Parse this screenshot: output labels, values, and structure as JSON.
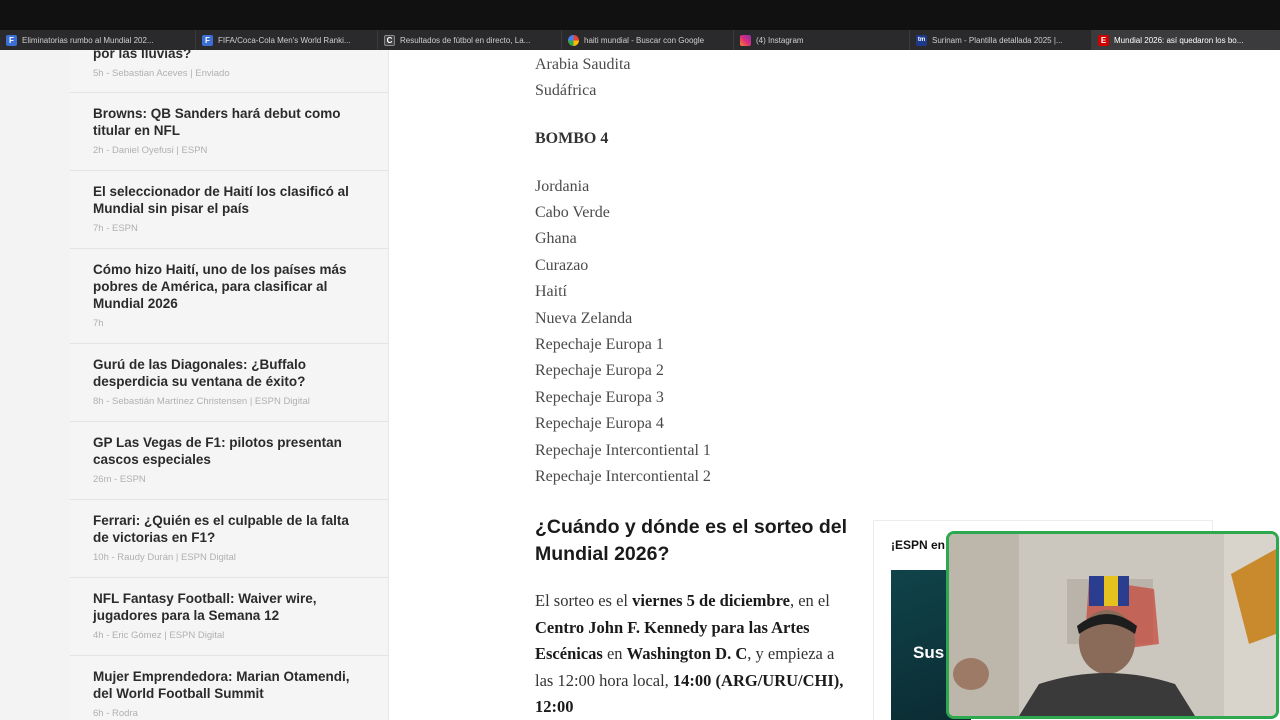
{
  "tabs": [
    {
      "label": "Eliminatorias rumbo al Mundial 202...",
      "icon": "f-icon",
      "color": "#3b6fd6"
    },
    {
      "label": "FIFA/Coca-Cola Men's World Ranki...",
      "icon": "f-icon",
      "color": "#3b6fd6"
    },
    {
      "label": "Resultados de fútbol en directo, La...",
      "icon": "c-icon",
      "color": "#444444"
    },
    {
      "label": "haiti mundial - Buscar con Google",
      "icon": "google-icon",
      "color": "#ea4335"
    },
    {
      "label": "(4) Instagram",
      "icon": "instagram-icon",
      "color": "#d6249f"
    },
    {
      "label": "Surinam - Plantilla detallada 2025 |...",
      "icon": "tm-icon",
      "color": "#1d3a8a"
    },
    {
      "label": "Mundial 2026: así quedaron los bo...",
      "icon": "espn-icon",
      "color": "#d00000"
    }
  ],
  "news": [
    {
      "title": "por las lluvias?",
      "meta": "5h  -  Sebastian Aceves | Enviado"
    },
    {
      "title": "Browns: QB Sanders hará debut como titular en NFL",
      "meta": "2h  -  Daniel Oyefusi | ESPN"
    },
    {
      "title": "El seleccionador de Haití los clasificó al Mundial sin pisar el país",
      "meta": "7h  -  ESPN"
    },
    {
      "title": "Cómo hizo Haití, uno de los países más pobres de América, para clasificar al Mundial 2026",
      "meta": "7h"
    },
    {
      "title": "Gurú de las Diagonales: ¿Buffalo desperdicia su ventana de éxito?",
      "meta": "8h  -  Sebastián Martínez Christensen | ESPN Digital"
    },
    {
      "title": "GP Las Vegas de F1: pilotos presentan cascos especiales",
      "meta": "26m  -  ESPN"
    },
    {
      "title": "Ferrari: ¿Quién es el culpable de la falta de victorias en F1?",
      "meta": "10h  -  Raudy Durán | ESPN Digital"
    },
    {
      "title": "NFL Fantasy Football: Waiver wire, jugadores para la Semana 12",
      "meta": "4h  -  Eric Gómez | ESPN Digital"
    },
    {
      "title": "Mujer Emprendedora: Marian Otamendi, del World Football Summit",
      "meta": "6h  -  Rodra"
    }
  ],
  "article": {
    "pot3_tail": [
      "Arabia Saudita",
      "Sudáfrica"
    ],
    "pot4_heading": "BOMBO 4",
    "pot4": [
      "Jordania",
      "Cabo Verde",
      "Ghana",
      "Curazao",
      "Haití",
      "Nueva Zelanda",
      "Repechaje Europa 1",
      "Repechaje Europa 2",
      "Repechaje Europa 3",
      "Repechaje Europa 4",
      "Repechaje Intercontiental 1",
      "Repechaje Intercontiental 2"
    ],
    "subheading": "¿Cuándo y dónde es el sorteo del Mundial 2026?",
    "para": {
      "t1": "El sorteo es el ",
      "b1": "viernes 5 de diciembre",
      "t2": ", en el ",
      "b2": "Centro John F. Kennedy para las Artes Escénicas",
      "t3": " en ",
      "b3": "Washington D. C",
      "t4": ", y empieza a las 12:00 hora local, ",
      "b4": "14:00 (ARG/URU/CHI), 12:00"
    }
  },
  "promo": {
    "title": "¡ESPN en",
    "image_text": "Sus"
  }
}
